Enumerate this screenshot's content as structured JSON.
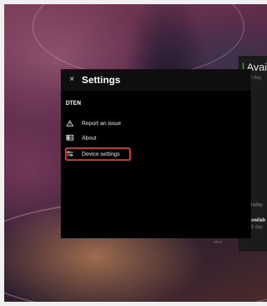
{
  "settings": {
    "title": "Settings",
    "close_glyph": "×",
    "section_label": "DTEN",
    "items": [
      {
        "label": "Report an issue",
        "icon": "warning-triangle-icon"
      },
      {
        "label": "About",
        "icon": "info-window-icon"
      },
      {
        "label": "Device settings",
        "icon": "sliders-icon",
        "highlighted": true
      }
    ]
  },
  "background_panel": {
    "title": "Avai",
    "sub1": "All day",
    "day": "ursday",
    "available": "Availab",
    "sub2": "All day"
  },
  "more_label": "More",
  "colors": {
    "highlight_border": "#e0412b",
    "available_accent": "#2e8b3a"
  }
}
